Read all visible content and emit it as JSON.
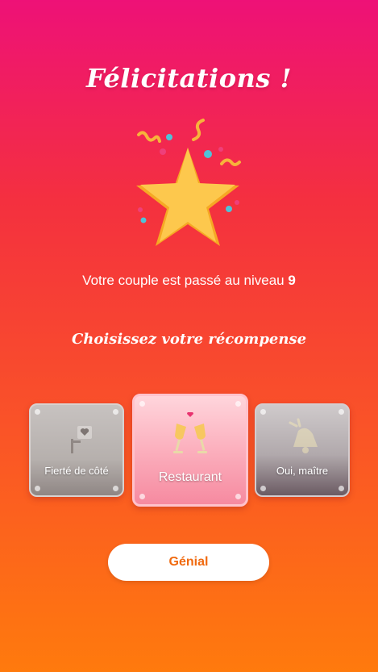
{
  "header": {
    "title": "Félicitations !"
  },
  "level": {
    "text": "Votre couple est passé au niveau",
    "number": "9"
  },
  "rewards": {
    "heading": "Choisissez votre récompense",
    "items": [
      {
        "label": "Fierté de côté",
        "icon": "heart-sign-icon",
        "selected": false
      },
      {
        "label": "Restaurant",
        "icon": "champagne-toast-icon",
        "selected": true
      },
      {
        "label": "Oui, maître",
        "icon": "bell-icon",
        "selected": false
      }
    ]
  },
  "action": {
    "button_label": "Génial"
  },
  "colors": {
    "accent": "#f06a10",
    "star": "#fcc74b",
    "background_top": "#ee1177",
    "background_bottom": "#ff7a0d"
  }
}
